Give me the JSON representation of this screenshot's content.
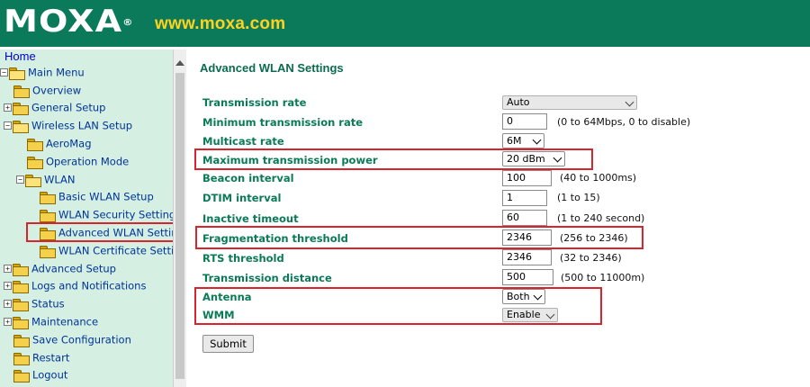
{
  "header": {
    "logo": "MOXA",
    "logo_mark": "®",
    "url": "www.moxa.com"
  },
  "sidebar": {
    "home": "Home",
    "items": [
      {
        "label": "Main Menu",
        "toggle": "−"
      },
      {
        "label": "Overview"
      },
      {
        "label": "General Setup",
        "toggle": "+"
      },
      {
        "label": "Wireless LAN Setup",
        "toggle": "−"
      },
      {
        "label": "AeroMag"
      },
      {
        "label": "Operation Mode"
      },
      {
        "label": "WLAN",
        "toggle": "−"
      },
      {
        "label": "Basic WLAN Setup"
      },
      {
        "label": "WLAN Security Settings"
      },
      {
        "label": "Advanced WLAN Settings"
      },
      {
        "label": "WLAN Certificate Settings"
      },
      {
        "label": "Advanced Setup",
        "toggle": "+"
      },
      {
        "label": "Logs and Notifications",
        "toggle": "+"
      },
      {
        "label": "Status",
        "toggle": "+"
      },
      {
        "label": "Maintenance",
        "toggle": "+"
      },
      {
        "label": "Save Configuration"
      },
      {
        "label": "Restart"
      },
      {
        "label": "Logout"
      }
    ]
  },
  "main": {
    "title": "Advanced WLAN Settings",
    "fields": {
      "transmission_rate": {
        "label": "Transmission rate",
        "value": "Auto"
      },
      "min_transmission_rate": {
        "label": "Minimum transmission rate",
        "value": "0",
        "hint": "(0 to 64Mbps, 0 to disable)"
      },
      "multicast_rate": {
        "label": "Multicast rate",
        "value": "6M"
      },
      "max_transmission_power": {
        "label": "Maximum transmission power",
        "value": "20 dBm"
      },
      "beacon_interval": {
        "label": "Beacon interval",
        "value": "100",
        "hint": "(40 to 1000ms)"
      },
      "dtim_interval": {
        "label": "DTIM interval",
        "value": "1",
        "hint": "(1 to 15)"
      },
      "inactive_timeout": {
        "label": "Inactive timeout",
        "value": "60",
        "hint": "(1 to 240 second)"
      },
      "fragmentation_threshold": {
        "label": "Fragmentation threshold",
        "value": "2346",
        "hint": "(256 to 2346)"
      },
      "rts_threshold": {
        "label": "RTS threshold",
        "value": "2346",
        "hint": "(32 to 2346)"
      },
      "transmission_distance": {
        "label": "Transmission distance",
        "value": "500",
        "hint": "(500 to 11000m)"
      },
      "antenna": {
        "label": "Antenna",
        "value": "Both"
      },
      "wmm": {
        "label": "WMM",
        "value": "Enable"
      }
    },
    "submit_label": "Submit"
  },
  "colors": {
    "header_bg": "#0a7a5a",
    "url_text": "#ffd21f",
    "sidebar_bg": "#d5f0e2",
    "label_green": "#0b7a56",
    "highlight_red": "#d8242c"
  }
}
